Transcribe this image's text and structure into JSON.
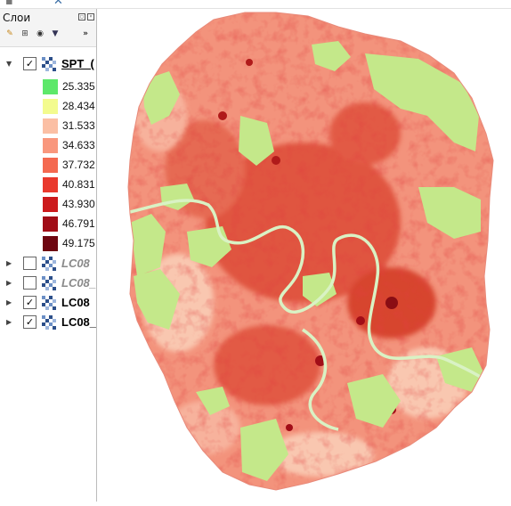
{
  "panel": {
    "title": "Слои",
    "toolbar": [
      "style-icon",
      "add-group-icon",
      "visibility-icon",
      "filter-icon",
      "more-icon"
    ]
  },
  "layers": [
    {
      "name": "SPT_(",
      "checked": true,
      "expanded": true,
      "active": true,
      "legend": [
        {
          "value": "25.335",
          "color": "#5de86a"
        },
        {
          "value": "28.434",
          "color": "#f3fb8e"
        },
        {
          "value": "31.533",
          "color": "#fbbfa4"
        },
        {
          "value": "34.633",
          "color": "#f9977d"
        },
        {
          "value": "37.732",
          "color": "#f46950"
        },
        {
          "value": "40.831",
          "color": "#e9392d"
        },
        {
          "value": "43.930",
          "color": "#cc1a1c"
        },
        {
          "value": "46.791",
          "color": "#a10d17"
        },
        {
          "value": "49.175",
          "color": "#6e0610"
        }
      ]
    },
    {
      "name": "LC08",
      "checked": false,
      "expanded": false,
      "active": false
    },
    {
      "name": "LC08_",
      "checked": false,
      "expanded": false,
      "active": false
    },
    {
      "name": "LC08",
      "checked": true,
      "expanded": false,
      "active": true
    },
    {
      "name": "LC08_",
      "checked": true,
      "expanded": false,
      "active": true
    }
  ],
  "map": {
    "palette": {
      "cool": "#c4e88a",
      "mild": "#f9c7b0",
      "warm": "#f3937c",
      "hot": "#e0553f",
      "hotspot": "#b01a1a"
    }
  }
}
